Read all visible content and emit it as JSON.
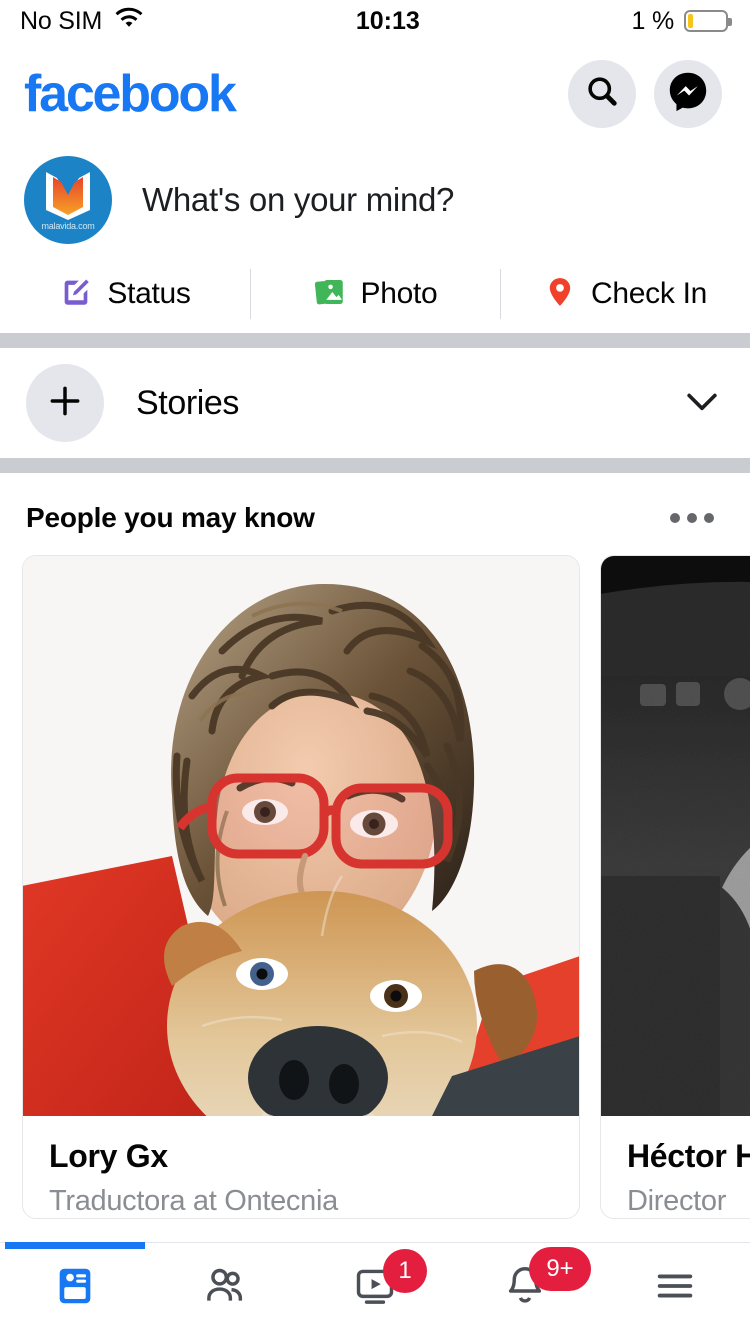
{
  "statusbar": {
    "carrier": "No SIM",
    "wifi_icon": "wifi-icon",
    "time": "10:13",
    "battery_percent": "1 %",
    "battery_icon": "battery-low-icon"
  },
  "header": {
    "logo": "facebook",
    "logo_color": "#1877F2",
    "search_icon": "search-icon",
    "messenger_icon": "messenger-icon",
    "icon_bg": "#E4E6EB"
  },
  "composer": {
    "avatar_name": "malavida.com",
    "avatar_bg": "#1C84C6",
    "prompt": "What's on your mind?"
  },
  "actions": [
    {
      "label": "Status",
      "icon": "status-pencil-icon",
      "color": "#7A5CD1"
    },
    {
      "label": "Photo",
      "icon": "photo-icon",
      "color": "#41B658"
    },
    {
      "label": "Check In",
      "icon": "location-pin-icon",
      "color": "#F0422A"
    }
  ],
  "stories": {
    "add_icon": "plus-icon",
    "label": "Stories",
    "chevron_icon": "chevron-down-icon"
  },
  "pymk": {
    "title": "People you may know",
    "menu_icon": "ellipsis-icon",
    "cards": [
      {
        "name": "Lory Gx",
        "subtitle": "Traductora at Ontecnia",
        "photo": "woman-with-curly-hair-red-glasses-hugging-tan-dog"
      },
      {
        "name": "Héctor H",
        "subtitle": "Director",
        "photo": "black-and-white-grainy-portrait"
      }
    ]
  },
  "bottomnav": {
    "active_color": "#1877F2",
    "badge_color": "#E41E3F",
    "tabs": [
      {
        "name": "news-feed",
        "icon": "news-feed-icon",
        "active": true,
        "badge": ""
      },
      {
        "name": "friends",
        "icon": "friends-icon",
        "active": false,
        "badge": ""
      },
      {
        "name": "watch",
        "icon": "watch-video-icon",
        "active": false,
        "badge": "1"
      },
      {
        "name": "notifications",
        "icon": "bell-icon",
        "active": false,
        "badge": "9+"
      },
      {
        "name": "menu",
        "icon": "hamburger-menu-icon",
        "active": false,
        "badge": ""
      }
    ]
  }
}
